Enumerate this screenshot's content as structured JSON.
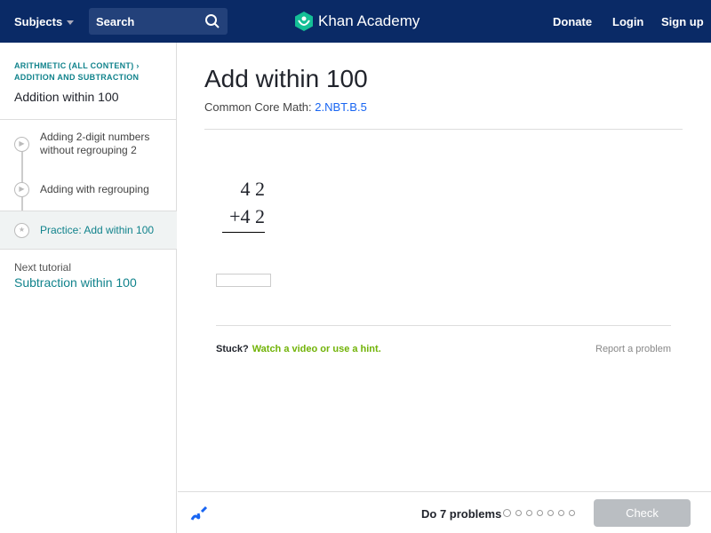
{
  "header": {
    "subjects": "Subjects",
    "search_placeholder": "Search",
    "logo": "Khan Academy",
    "donate": "Donate",
    "login": "Login",
    "signup": "Sign up"
  },
  "sidebar": {
    "breadcrumb1": "ARITHMETIC (ALL CONTENT)",
    "breadcrumb2": "ADDITION AND SUBTRACTION",
    "title": "Addition within 100",
    "items": [
      {
        "label": "Adding 2-digit numbers without regrouping 2"
      },
      {
        "label": "Adding with regrouping"
      },
      {
        "label": "Practice: Add within 100"
      }
    ],
    "next_label": "Next tutorial",
    "next_link": "Subtraction within 100"
  },
  "main": {
    "title": "Add within 100",
    "cc_label": "Common Core Math:",
    "cc_link": "2.NBT.B.5",
    "top": "4 2",
    "bottom": "+4 2",
    "answer": "",
    "stuck": "Stuck?",
    "hint": "Watch a video or use a hint.",
    "report": "Report a problem"
  },
  "footer": {
    "do": "Do 7 problems",
    "check": "Check"
  }
}
